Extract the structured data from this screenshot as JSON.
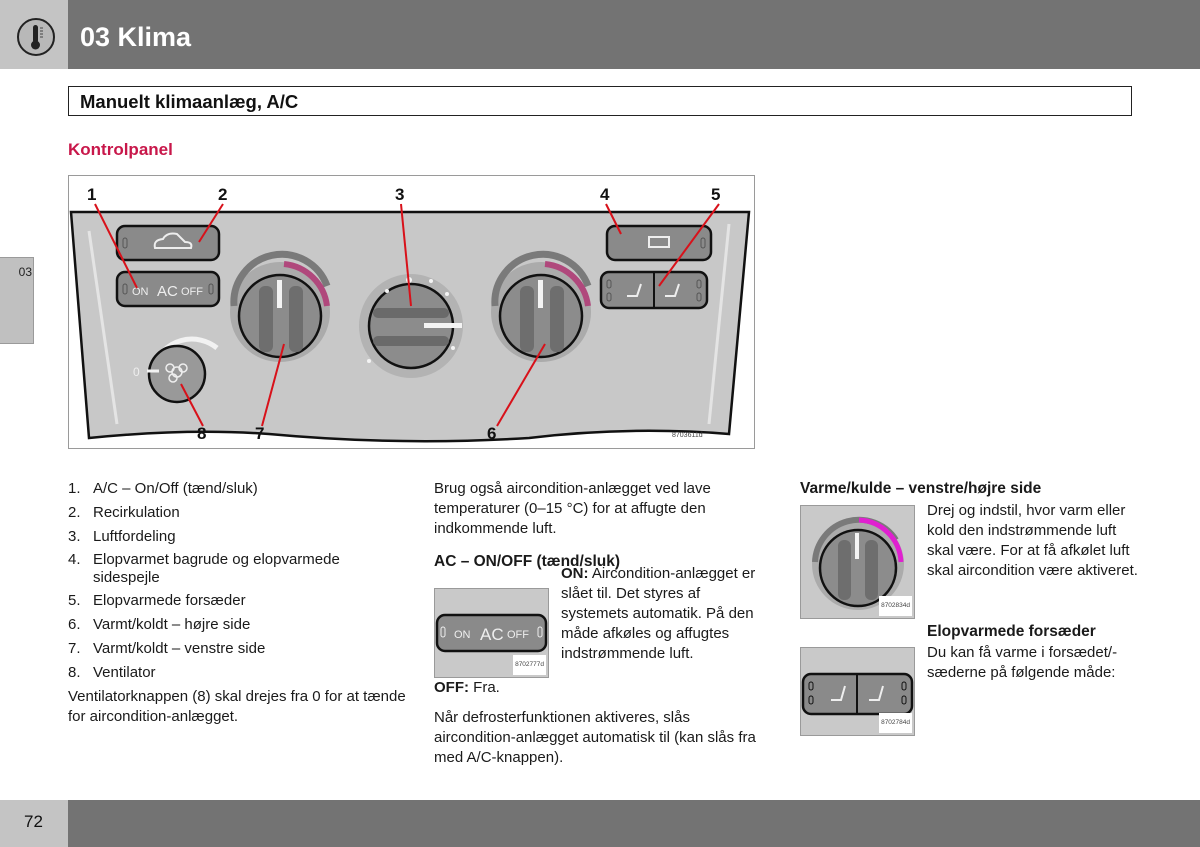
{
  "header": {
    "chapter_title": "03 Klima",
    "chapter_icon": "thermometer-icon"
  },
  "side_tab": {
    "label": "03"
  },
  "section": {
    "title": "Manuelt klimaanlæg, A/C",
    "subheading": "Kontrolpanel"
  },
  "figure": {
    "code": "8703611d",
    "callouts": [
      "1",
      "2",
      "3",
      "4",
      "5",
      "6",
      "7",
      "8"
    ],
    "panel_labels": {
      "on": "ON",
      "ac": "AC",
      "off": "OFF",
      "fan_zero": "0"
    },
    "accent_color": "#b0487c",
    "callout_line_color": "#d8111a"
  },
  "col1": {
    "items": [
      {
        "n": "1.",
        "text": "A/C – On/Off (tænd/sluk)"
      },
      {
        "n": "2.",
        "text": "Recirkulation"
      },
      {
        "n": "3.",
        "text": "Luftfordeling"
      },
      {
        "n": "4.",
        "text": "Elopvarmet bagrude og elopvarmede sidespejle"
      },
      {
        "n": "5.",
        "text": "Elopvarmede forsæder"
      },
      {
        "n": "6.",
        "text": "Varmt/koldt – højre side"
      },
      {
        "n": "7.",
        "text": "Varmt/koldt – venstre side"
      },
      {
        "n": "8.",
        "text": "Ventilator"
      }
    ],
    "note": "Ventilatorknappen (8) skal drejes fra 0 for at tænde for aircondition-anlægget."
  },
  "col2": {
    "intro": "Brug også aircondition-anlægget ved lave temperaturer (0–15 °C) for at affugte den indkommende luft.",
    "heading": "AC – ON/OFF (tænd/sluk)",
    "thumb_code": "8702777d",
    "on_label": "ON:",
    "on_text": "Aircondition-anlægget er slået til. Det styres af systemets automatik. På den måde afkøles og affugtes indstrømmende luft.",
    "off_label": "OFF:",
    "off_text": "Fra.",
    "defrost_text": "Når defrosterfunktionen aktiveres, slås aircondition-anlægget automatisk til (kan slås fra med A/C-knappen)."
  },
  "col3": {
    "heading1": "Varme/kulde – venstre/højre side",
    "thumb1_code": "8702834d",
    "text1": "Drej og indstil, hvor varm eller kold den indstrømmende luft skal være. For at få afkølet luft skal aircondition være aktiveret.",
    "heading2": "Elopvarmede forsæder",
    "thumb2_code": "8702784d",
    "text2": "Du kan få varme i forsædet/-sæderne på følgende måde:"
  },
  "footer": {
    "page_number": "72"
  }
}
